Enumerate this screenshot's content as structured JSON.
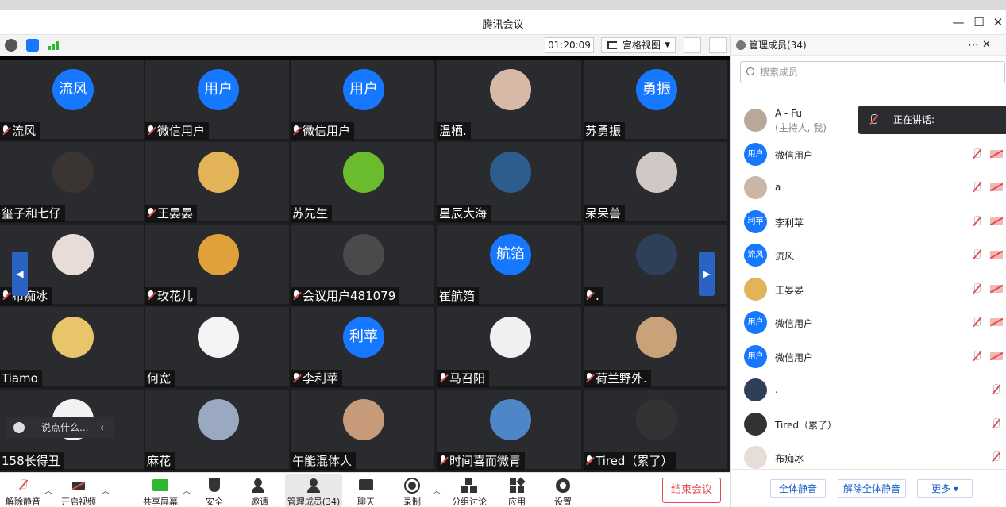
{
  "window": {
    "title": "腾讯会议"
  },
  "toolbar": {
    "timer": "01:20:09",
    "view_mode": "宫格视图"
  },
  "tiles": [
    {
      "name": "流风",
      "avatar_text": "流风",
      "avatar_color": "#1677ff",
      "muted": true
    },
    {
      "name": "微信用户",
      "avatar_text": "用户",
      "avatar_color": "#1677ff",
      "muted": true
    },
    {
      "name": "微信用户",
      "avatar_text": "用户",
      "avatar_color": "#1677ff",
      "muted": true
    },
    {
      "name": "温栖.",
      "avatar_text": "",
      "avatar_color": "#d8b9a8",
      "muted": false
    },
    {
      "name": "苏勇振",
      "avatar_text": "勇振",
      "avatar_color": "#1677ff",
      "muted": false
    },
    {
      "name": "玺子和七仔",
      "avatar_text": "",
      "avatar_color": "#3a3532",
      "muted": false
    },
    {
      "name": "王晏晏",
      "avatar_text": "",
      "avatar_color": "#e2b457",
      "muted": true
    },
    {
      "name": "苏先生",
      "avatar_text": "",
      "avatar_color": "#6abb2e",
      "muted": false
    },
    {
      "name": "星辰大海",
      "avatar_text": "",
      "avatar_color": "#2c5d8c",
      "muted": false
    },
    {
      "name": "呆呆兽",
      "avatar_text": "",
      "avatar_color": "#cfc8c4",
      "muted": false
    },
    {
      "name": "布痴冰",
      "avatar_text": "",
      "avatar_color": "#e8dcd8",
      "muted": true
    },
    {
      "name": "玫花儿",
      "avatar_text": "",
      "avatar_color": "#e0a03a",
      "muted": true
    },
    {
      "name": "会议用户481079",
      "avatar_text": "",
      "avatar_color": "#4a4a4a",
      "muted": true
    },
    {
      "name": "崔航箔",
      "avatar_text": "航箔",
      "avatar_color": "#1677ff",
      "muted": false
    },
    {
      "name": ".",
      "avatar_text": "",
      "avatar_color": "#2d4058",
      "muted": true
    },
    {
      "name": "Tiamo",
      "avatar_text": "",
      "avatar_color": "#e8c46a",
      "muted": false
    },
    {
      "name": "何宽",
      "avatar_text": "",
      "avatar_color": "#f4f4f4",
      "muted": false
    },
    {
      "name": "李利苹",
      "avatar_text": "利苹",
      "avatar_color": "#1677ff",
      "muted": true
    },
    {
      "name": "马召阳",
      "avatar_text": "",
      "avatar_color": "#f0f0f0",
      "muted": true
    },
    {
      "name": "荷兰野外.",
      "avatar_text": "",
      "avatar_color": "#c9a27a",
      "muted": true
    },
    {
      "name": "158长得丑",
      "avatar_text": "",
      "avatar_color": "#f2f2f2",
      "muted": false
    },
    {
      "name": "麻花",
      "avatar_text": "",
      "avatar_color": "#9aa8c0",
      "muted": false
    },
    {
      "name": "午能混体人",
      "avatar_text": "",
      "avatar_color": "#c79b7a",
      "muted": false
    },
    {
      "name": "时间喜而微青",
      "avatar_text": "",
      "avatar_color": "#4f86c8",
      "muted": true
    },
    {
      "name": "Tired（累了）",
      "avatar_text": "",
      "avatar_color": "#333333",
      "muted": true
    }
  ],
  "chat": {
    "placeholder": "说点什么..."
  },
  "bottom": {
    "unmute": "解除静音",
    "video": "开启视频",
    "share": "共享屏幕",
    "security": "安全",
    "invite": "邀请",
    "members": "管理成员(34)",
    "chat": "聊天",
    "record": "录制",
    "breakout": "分组讨论",
    "apps": "应用",
    "settings": "设置",
    "end": "结束会议"
  },
  "panel": {
    "title": "管理成员(34)",
    "search_placeholder": "搜索成员",
    "speaking": "正在讲话:",
    "members": [
      {
        "name": "A - Fu",
        "sub": "(主持人, 我)",
        "avatar_text": "",
        "avatar_color": "#b8a89a",
        "mic": false,
        "cam": false
      },
      {
        "name": "微信用户",
        "sub": "",
        "avatar_text": "用户",
        "avatar_color": "#1677ff",
        "mic": true,
        "cam": true
      },
      {
        "name": "a",
        "sub": "",
        "avatar_text": "",
        "avatar_color": "#c9b6a6",
        "mic": true,
        "cam": true
      },
      {
        "name": "李利苹",
        "sub": "",
        "avatar_text": "利苹",
        "avatar_color": "#1677ff",
        "mic": true,
        "cam": true
      },
      {
        "name": "流风",
        "sub": "",
        "avatar_text": "流风",
        "avatar_color": "#1677ff",
        "mic": true,
        "cam": true
      },
      {
        "name": "王晏晏",
        "sub": "",
        "avatar_text": "",
        "avatar_color": "#e2b457",
        "mic": true,
        "cam": true
      },
      {
        "name": "微信用户",
        "sub": "",
        "avatar_text": "用户",
        "avatar_color": "#1677ff",
        "mic": true,
        "cam": true
      },
      {
        "name": "微信用户",
        "sub": "",
        "avatar_text": "用户",
        "avatar_color": "#1677ff",
        "mic": true,
        "cam": true
      },
      {
        "name": ".",
        "sub": "",
        "avatar_text": "",
        "avatar_color": "#2d4058",
        "mic": true,
        "cam": false
      },
      {
        "name": "Tired（累了）",
        "sub": "",
        "avatar_text": "",
        "avatar_color": "#333333",
        "mic": true,
        "cam": false
      },
      {
        "name": "布痴冰",
        "sub": "",
        "avatar_text": "",
        "avatar_color": "#e8dcd8",
        "mic": true,
        "cam": false
      }
    ],
    "mute_all": "全体静音",
    "unmute_all": "解除全体静音",
    "more": "更多"
  }
}
